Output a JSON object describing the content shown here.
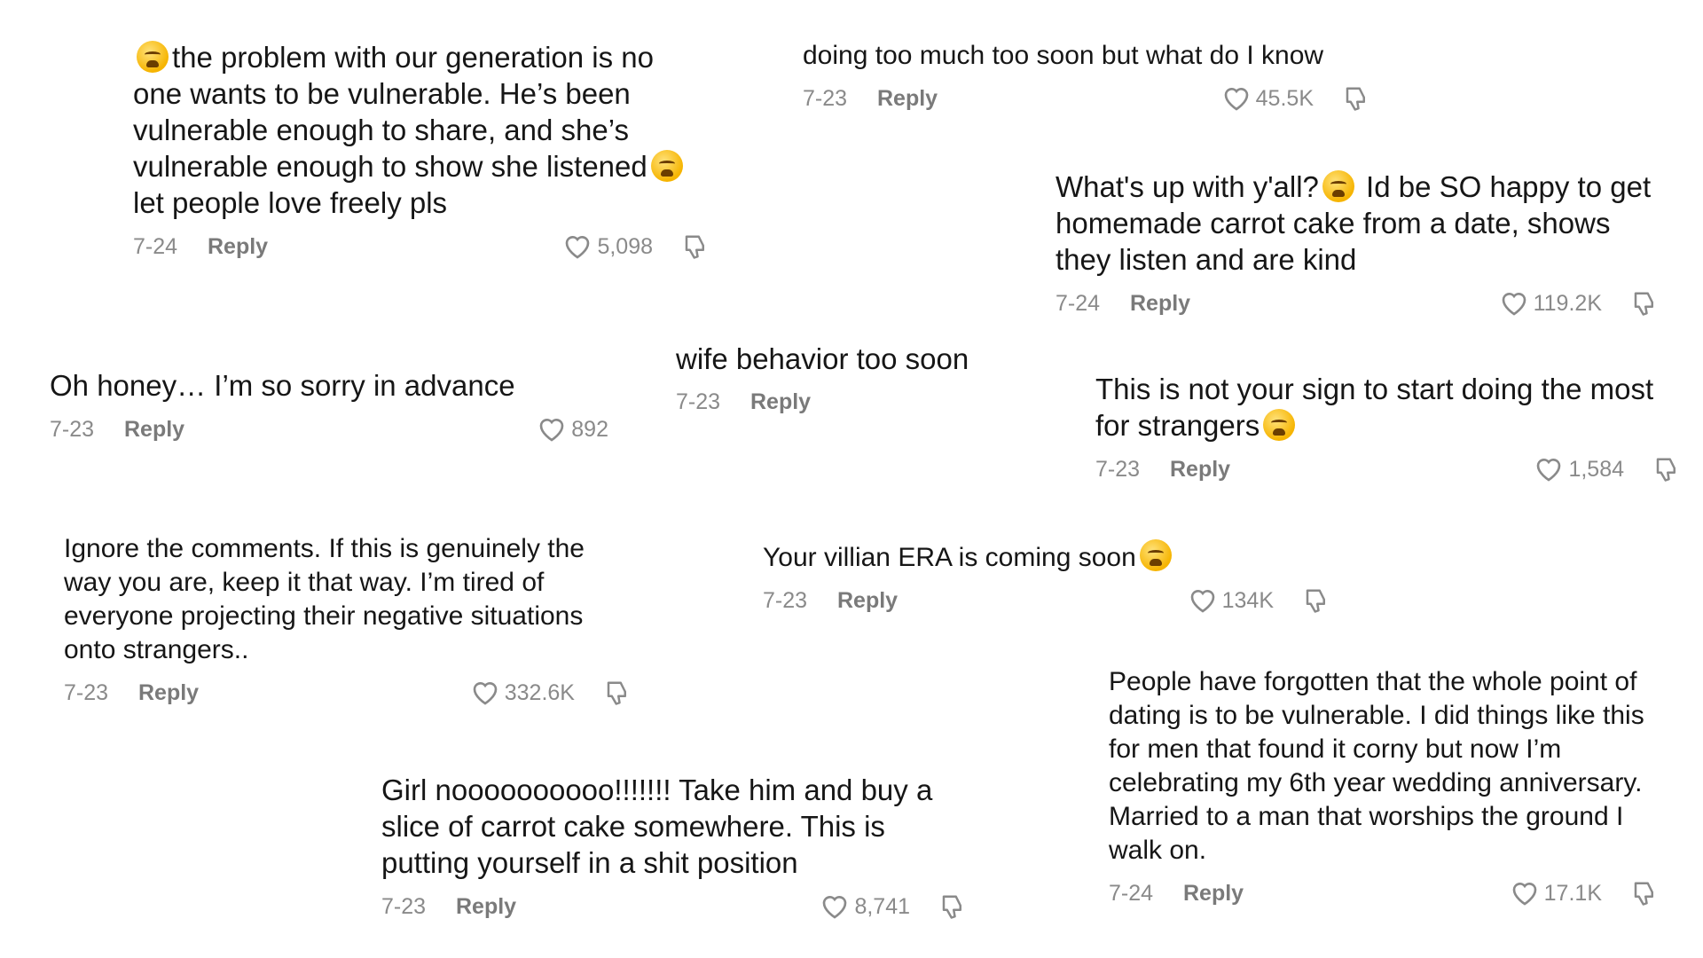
{
  "comments": [
    {
      "text": "the problem with our generation is no one wants to be vulnerable. He’s been vulnerable enough to share, and she’s vulnerable enough to show she listened",
      "text_after": " let people love freely pls",
      "date": "7-24",
      "reply": "Reply",
      "likes": "5,098"
    },
    {
      "text": "doing too much too soon but what do I know",
      "date": "7-23",
      "reply": "Reply",
      "likes": "45.5K"
    },
    {
      "text": "What's up with y'all?",
      "text_after": " Id be SO happy to get homemade carrot cake from a date, shows they listen and are kind",
      "date": "7-24",
      "reply": "Reply",
      "likes": "119.2K"
    },
    {
      "text": "Oh honey… I’m so sorry in advance",
      "date": "7-23",
      "reply": "Reply",
      "likes": "892"
    },
    {
      "text": "wife behavior too soon",
      "date": "7-23",
      "reply": "Reply"
    },
    {
      "text": "This is not your sign to start doing the most for strangers",
      "date": "7-23",
      "reply": "Reply",
      "likes": "1,584"
    },
    {
      "text": "Ignore the comments. If this is genuinely the way you are, keep it that way. I’m tired of everyone projecting their negative situations onto strangers..",
      "date": "7-23",
      "reply": "Reply",
      "likes": "332.6K"
    },
    {
      "text": "Your villian ERA is coming soon",
      "date": "7-23",
      "reply": "Reply",
      "likes": "134K"
    },
    {
      "text": "Girl noooooooooo!!!!!!! Take him and buy a slice of carrot cake somewhere. This is putting yourself in a shit position",
      "date": "7-23",
      "reply": "Reply",
      "likes": "8,741"
    },
    {
      "text": "People have forgotten that the whole point of dating is to be vulnerable. I did things like this for men that found it corny but now I’m celebrating my 6th year wedding anniversary. Married to a man that worships the ground I walk on.",
      "date": "7-24",
      "reply": "Reply",
      "likes": "17.1K"
    }
  ],
  "icons": {
    "like": "heart-outline-icon",
    "dislike": "thumbs-down-outline-icon",
    "emoji_crying": "loudly-crying-face-emoji",
    "emoji_weary": "weary-face-emoji"
  },
  "colors": {
    "text": "#161616",
    "meta": "#8a8a8a",
    "background": "#ffffff"
  }
}
